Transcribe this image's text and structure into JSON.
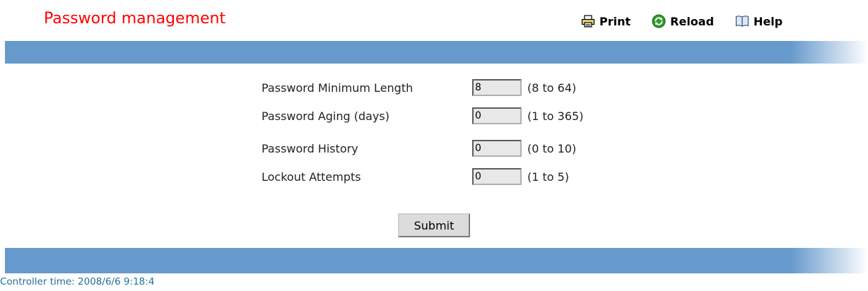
{
  "page": {
    "title": "Password management"
  },
  "toolbar": {
    "print_label": "Print",
    "reload_label": "Reload",
    "help_label": "Help"
  },
  "form": {
    "rows": [
      {
        "label": "Password Minimum Length",
        "value": "8",
        "range": "(8 to 64)"
      },
      {
        "label": "Password Aging (days)",
        "value": "0",
        "range": "(1 to 365)"
      },
      {
        "label": "Password History",
        "value": "0",
        "range": "(0 to 10)"
      },
      {
        "label": "Lockout Attempts",
        "value": "0",
        "range": "(1 to 5)"
      }
    ],
    "submit_label": "Submit"
  },
  "footer": {
    "controller_time": "Controller time: 2008/6/6 9:18:4"
  },
  "colors": {
    "title": "#ff0000",
    "bar": "#6699cc",
    "footer_text": "#1f6ea0"
  },
  "icons": {
    "print": "printer-icon",
    "reload": "reload-icon",
    "help": "book-icon"
  }
}
